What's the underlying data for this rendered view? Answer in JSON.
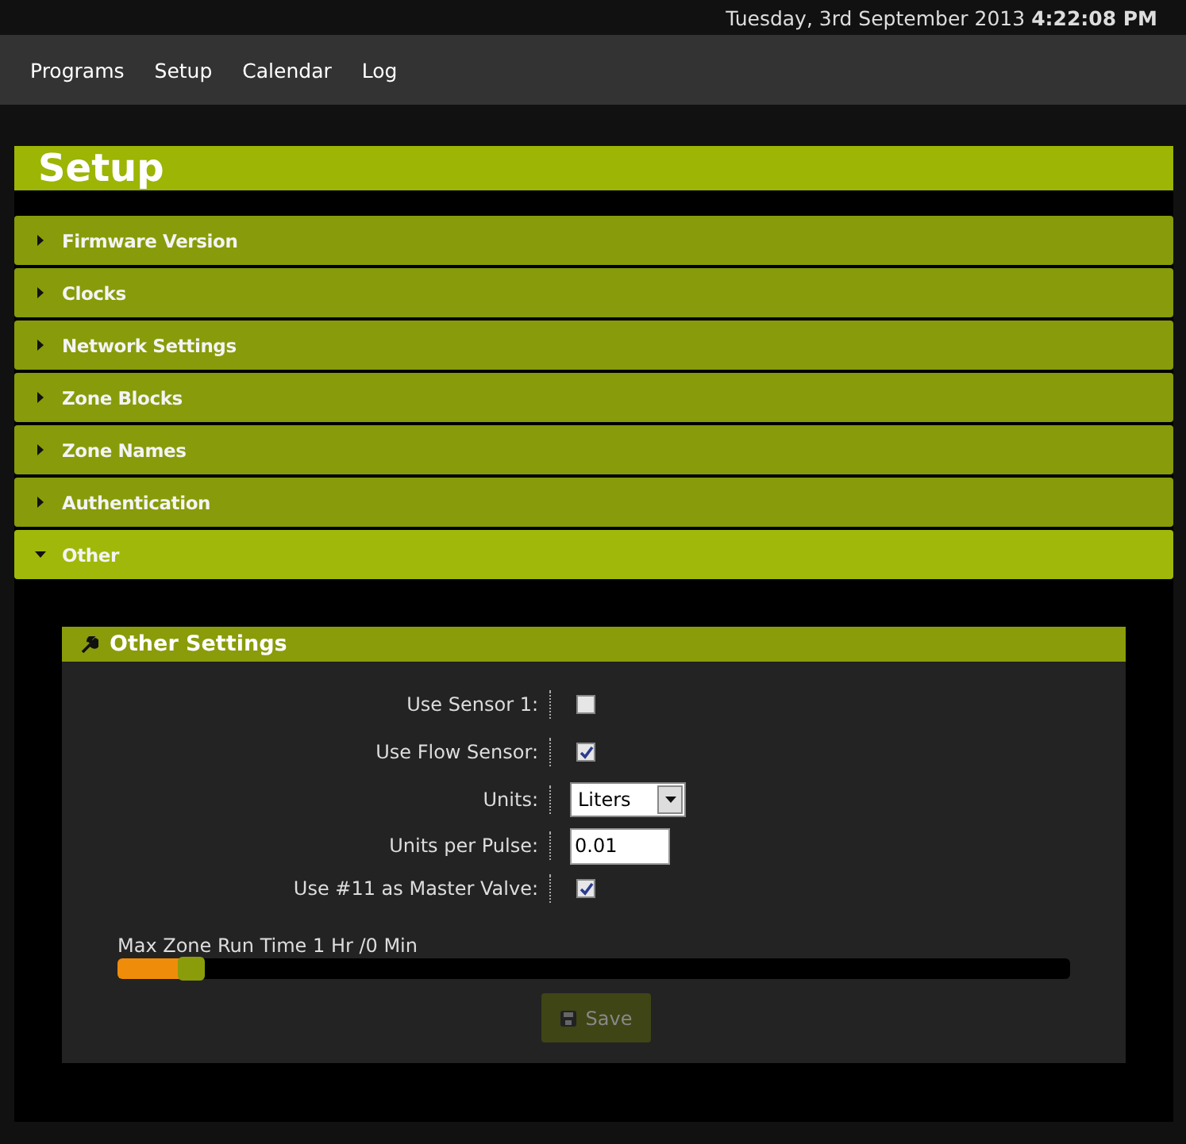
{
  "topbar": {
    "date": "Tuesday, 3rd September 2013",
    "time": "4:22:08 PM"
  },
  "nav": [
    {
      "label": "Programs"
    },
    {
      "label": "Setup"
    },
    {
      "label": "Calendar"
    },
    {
      "label": "Log"
    }
  ],
  "page_title": "Setup",
  "sections": [
    {
      "label": "Firmware Version",
      "expanded": false
    },
    {
      "label": "Clocks",
      "expanded": false
    },
    {
      "label": "Network Settings",
      "expanded": false
    },
    {
      "label": "Zone Blocks",
      "expanded": false
    },
    {
      "label": "Zone Names",
      "expanded": false
    },
    {
      "label": "Authentication",
      "expanded": false
    },
    {
      "label": "Other",
      "expanded": true
    }
  ],
  "panel": {
    "title": "Other Settings",
    "settings": [
      {
        "kind": "checkbox",
        "label": "Use Sensor 1:",
        "checked": false
      },
      {
        "kind": "checkbox",
        "label": "Use Flow Sensor:",
        "checked": true
      },
      {
        "kind": "select",
        "label": "Units:",
        "value": "Liters"
      },
      {
        "kind": "text",
        "label": "Units per Pulse:",
        "value": "0.01"
      },
      {
        "kind": "checkbox",
        "label": "Use #11 as Master Valve:",
        "checked": true
      }
    ],
    "slider": {
      "label": "Max Zone Run Time 1 Hr /0 Min",
      "level": 0.08
    },
    "save": {
      "label": "Save",
      "disabled": true
    }
  }
}
